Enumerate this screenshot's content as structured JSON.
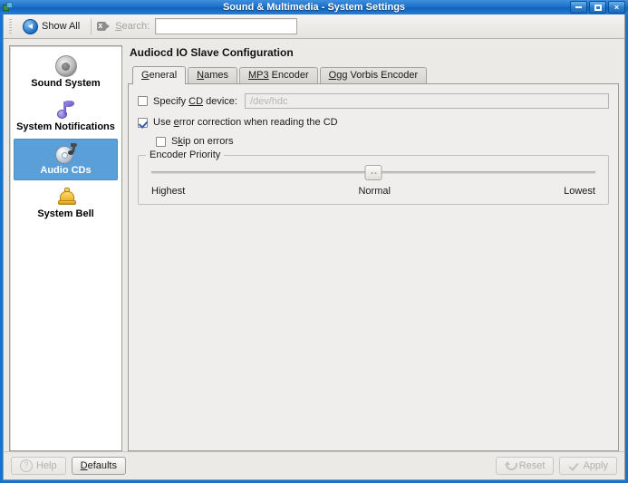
{
  "window": {
    "title": "Sound & Multimedia - System Settings",
    "icon": "system-settings-icon",
    "controls": {
      "minimize": "minimize-button",
      "maximize": "maximize-button",
      "close": "×"
    }
  },
  "toolbar": {
    "show_all_label": "Show All",
    "back_icon": "back-arrow-icon",
    "clear_icon": "clear-search-icon",
    "search_label_pre": "S",
    "search_label_post": "earch:",
    "search_value": "",
    "search_placeholder": ""
  },
  "sidebar": {
    "items": [
      {
        "label": "Sound System",
        "icon": "speaker-icon",
        "selected": false
      },
      {
        "label": "System Notifications",
        "icon": "music-note-icon",
        "selected": false
      },
      {
        "label": "Audio CDs",
        "icon": "audio-cd-icon",
        "selected": true
      },
      {
        "label": "System Bell",
        "icon": "bell-icon",
        "selected": false
      }
    ]
  },
  "main": {
    "page_title": "Audiocd IO Slave Configuration",
    "tabs": [
      {
        "accel": "G",
        "rest": "eneral",
        "active": true
      },
      {
        "accel": "N",
        "rest": "ames",
        "active": false
      },
      {
        "accel": "MP3",
        "rest": " Encoder",
        "active": false
      },
      {
        "accel": "O",
        "rest": "gg Vorbis Encoder",
        "active": false
      }
    ],
    "general": {
      "specify_device": {
        "label_pre": "Specify ",
        "label_accel": "CD",
        "label_post": " device:",
        "checked": false,
        "field_placeholder": "/dev/hdc",
        "field_value": "",
        "enabled": false
      },
      "error_correction": {
        "label_pre": "Use ",
        "label_accel": "e",
        "label_post": "rror correction when reading the CD",
        "checked": true
      },
      "skip_on_errors": {
        "label_pre": "S",
        "label_accel": "k",
        "label_post": "ip on errors",
        "checked": false
      },
      "encoder_priority": {
        "group_title": "Encoder Priority",
        "left_label": "Highest",
        "center_label": "Normal",
        "right_label": "Lowest",
        "value_percent": 50
      }
    }
  },
  "footer": {
    "help": {
      "label": "Help",
      "accel": "H",
      "icon": "help-icon",
      "enabled": false
    },
    "defaults": {
      "label_pre": "",
      "label_accel": "D",
      "label_post": "efaults",
      "enabled": true
    },
    "reset": {
      "label": "Reset",
      "accel": "R",
      "icon": "undo-icon",
      "enabled": false
    },
    "apply": {
      "label": "Apply",
      "accel": "A",
      "icon": "check-icon",
      "enabled": false
    }
  },
  "colors": {
    "titlebar": "#1873cf",
    "selection": "#5b9fd9",
    "panel": "#f0eeec",
    "background": "#eceae7"
  }
}
